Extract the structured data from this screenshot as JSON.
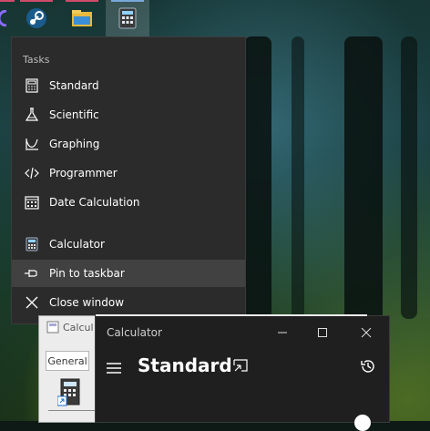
{
  "taskbar": {
    "items": [
      {
        "name": "app-icon-partial"
      },
      {
        "name": "steam-icon"
      },
      {
        "name": "file-explorer-icon"
      },
      {
        "name": "calculator-icon",
        "active": true
      }
    ],
    "colors": {
      "strip": "#d24a6a",
      "active_bg": "#4a4a4a"
    }
  },
  "jumplist": {
    "header": "Tasks",
    "tasks": [
      {
        "label": "Standard",
        "icon": "calculator-icon"
      },
      {
        "label": "Scientific",
        "icon": "flask-icon"
      },
      {
        "label": "Graphing",
        "icon": "graph-icon"
      },
      {
        "label": "Programmer",
        "icon": "code-icon"
      },
      {
        "label": "Date Calculation",
        "icon": "calendar-icon"
      }
    ],
    "app": {
      "label": "Calculator",
      "icon": "calculator-app-icon"
    },
    "pin": {
      "label": "Pin to taskbar",
      "icon": "pin-icon"
    },
    "close": {
      "label": "Close window",
      "icon": "close-icon"
    }
  },
  "old_calculator": {
    "title": "Calcul",
    "tab": "General"
  },
  "calculator": {
    "title": "Calculator",
    "mode": "Standard"
  }
}
